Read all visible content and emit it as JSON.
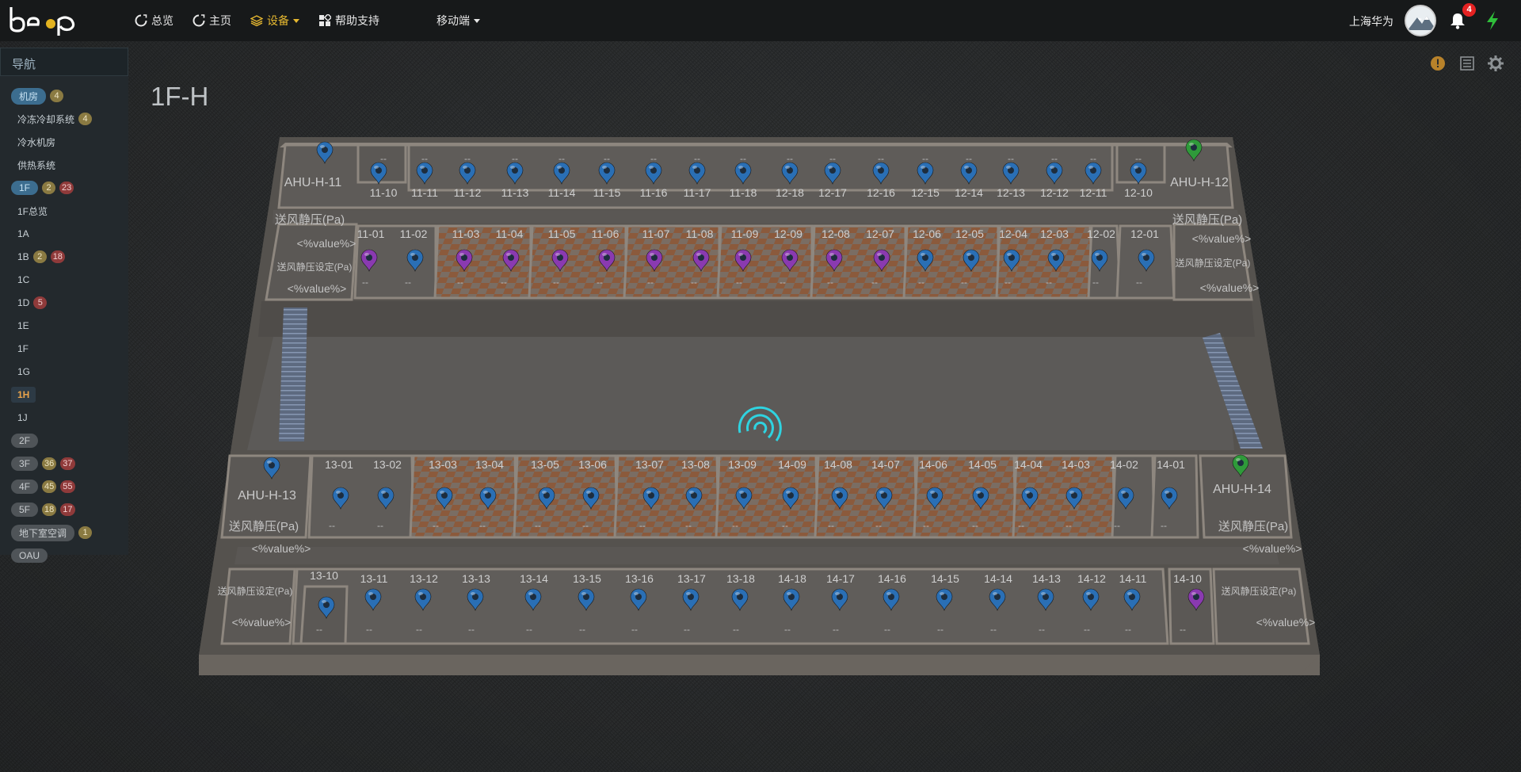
{
  "nav": {
    "overview": "总览",
    "home": "主页",
    "device": "设备",
    "help": "帮助支持",
    "mobile": "移动端"
  },
  "user": {
    "name": "上海华为",
    "notifications": "4"
  },
  "sidebar": {
    "title": "导航",
    "items": [
      {
        "label": "机房",
        "b1": "4",
        "b2": ""
      },
      {
        "label": "冷冻冷却系统",
        "b1": "4",
        "b2": ""
      },
      {
        "label": "冷水机房",
        "b1": "",
        "b2": ""
      },
      {
        "label": "供热系统",
        "b1": "",
        "b2": ""
      },
      {
        "label": "1F",
        "b1": "2",
        "b2": "23"
      },
      {
        "label": "1F总览",
        "b1": "",
        "b2": ""
      },
      {
        "label": "1A",
        "b1": "",
        "b2": ""
      },
      {
        "label": "1B",
        "b1": "2",
        "b2": "18"
      },
      {
        "label": "1C",
        "b1": "",
        "b2": ""
      },
      {
        "label": "1D",
        "b1": "",
        "b2": "5"
      },
      {
        "label": "1E",
        "b1": "",
        "b2": ""
      },
      {
        "label": "1F",
        "b1": "",
        "b2": ""
      },
      {
        "label": "1G",
        "b1": "",
        "b2": ""
      },
      {
        "label": "1H",
        "b1": "",
        "b2": ""
      },
      {
        "label": "1J",
        "b1": "",
        "b2": ""
      },
      {
        "label": "2F",
        "b1": "",
        "b2": ""
      },
      {
        "label": "3F",
        "b1": "36",
        "b2": "37"
      },
      {
        "label": "4F",
        "b1": "45",
        "b2": "55"
      },
      {
        "label": "5F",
        "b1": "18",
        "b2": "17"
      },
      {
        "label": "地下室空调",
        "b1": "1",
        "b2": ""
      },
      {
        "label": "OAU",
        "b1": "",
        "b2": ""
      }
    ]
  },
  "page_title": "1F-H",
  "plan": {
    "ahu": [
      "AHU-H-11",
      "AHU-H-12",
      "AHU-H-13",
      "AHU-H-14"
    ],
    "pressure_label": "送风静压(Pa)",
    "pressure_set_label": "送风静压设定(Pa)",
    "value_placeholder": "<%value%>",
    "dash": "--",
    "row1": [
      "11-10",
      "11-11",
      "11-12",
      "11-13",
      "11-14",
      "11-15",
      "11-16",
      "11-17",
      "11-18",
      "12-18",
      "12-17",
      "12-16",
      "12-15",
      "12-14",
      "12-13",
      "12-12",
      "12-11",
      "12-10"
    ],
    "row2": [
      "11-01",
      "11-02",
      "11-03",
      "11-04",
      "11-05",
      "11-06",
      "11-07",
      "11-08",
      "11-09",
      "12-09",
      "12-08",
      "12-07",
      "12-06",
      "12-05",
      "12-04",
      "12-03",
      "12-02",
      "12-01"
    ],
    "row3": [
      "13-01",
      "13-02",
      "13-03",
      "13-04",
      "13-05",
      "13-06",
      "13-07",
      "13-08",
      "13-09",
      "14-09",
      "14-08",
      "14-07",
      "14-06",
      "14-05",
      "14-04",
      "14-03",
      "14-02",
      "14-01"
    ],
    "row4": [
      "13-10",
      "13-11",
      "13-12",
      "13-13",
      "13-14",
      "13-15",
      "13-16",
      "13-17",
      "13-18",
      "14-18",
      "14-17",
      "14-16",
      "14-15",
      "14-14",
      "14-13",
      "14-12",
      "14-11",
      "14-10"
    ],
    "colors": {
      "blue": "#2a6fb5",
      "purple": "#8a3ab0",
      "green": "#2f9a3a",
      "spinner": "#2fd3e0"
    }
  }
}
